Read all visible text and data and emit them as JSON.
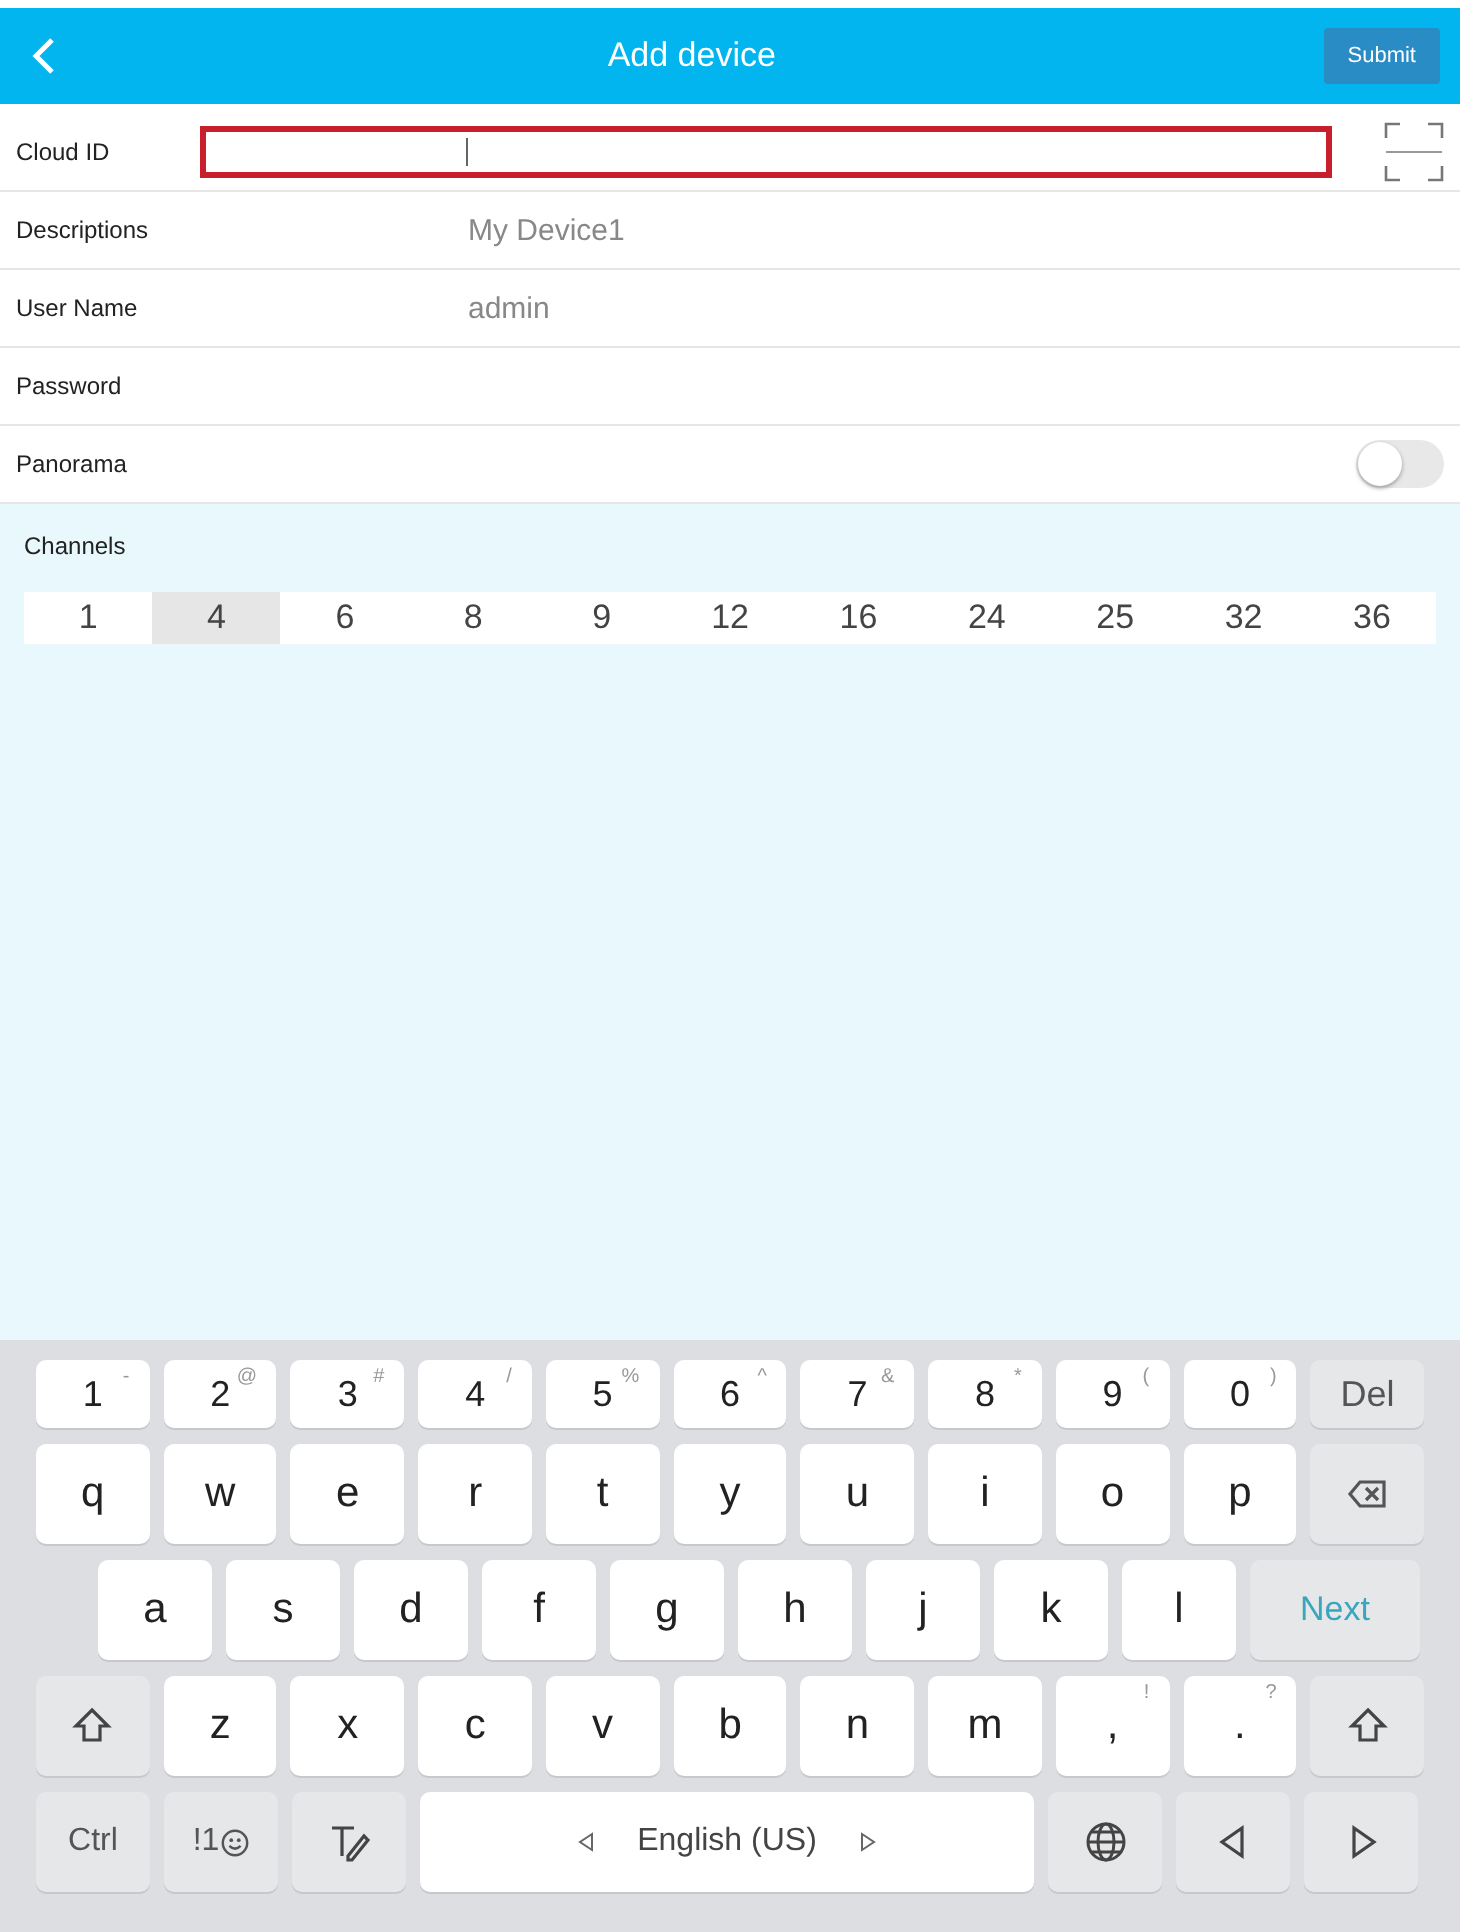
{
  "header": {
    "title": "Add device",
    "submit": "Submit"
  },
  "fields": [
    {
      "label": "Cloud ID",
      "kind": "input",
      "focused": true
    },
    {
      "label": "Descriptions",
      "kind": "input",
      "value": "My Device1"
    },
    {
      "label": "User Name",
      "kind": "input",
      "value": "admin"
    },
    {
      "label": "Password",
      "kind": "input"
    },
    {
      "label": "Panorama",
      "kind": "toggle",
      "on": false
    }
  ],
  "channels": {
    "label": "Channels",
    "options": [
      {
        "label": "1",
        "selected": false
      },
      {
        "label": "4",
        "selected": true
      },
      {
        "label": "6",
        "selected": false
      },
      {
        "label": "8",
        "selected": false
      },
      {
        "label": "9",
        "selected": false
      },
      {
        "label": "12",
        "selected": false
      },
      {
        "label": "16",
        "selected": false
      },
      {
        "label": "24",
        "selected": false
      },
      {
        "label": "25",
        "selected": false
      },
      {
        "label": "32",
        "selected": false
      },
      {
        "label": "36",
        "selected": false
      }
    ]
  },
  "keyboard": {
    "rows": [
      {
        "keys": [
          {
            "kind": "char",
            "label": "1",
            "alt": "-"
          },
          {
            "kind": "char",
            "label": "2",
            "alt": "@"
          },
          {
            "kind": "char",
            "label": "3",
            "alt": "#"
          },
          {
            "kind": "char",
            "label": "4",
            "alt": "/"
          },
          {
            "kind": "char",
            "label": "5",
            "alt": "%"
          },
          {
            "kind": "char",
            "label": "6",
            "alt": "^"
          },
          {
            "kind": "char",
            "label": "7",
            "alt": "&"
          },
          {
            "kind": "char",
            "label": "8",
            "alt": "*"
          },
          {
            "kind": "char",
            "label": "9",
            "alt": "("
          },
          {
            "kind": "char",
            "label": "0",
            "alt": ")"
          },
          {
            "kind": "word",
            "label": "Del"
          }
        ]
      },
      {
        "keys": [
          {
            "kind": "char",
            "label": "q"
          },
          {
            "kind": "char",
            "label": "w"
          },
          {
            "kind": "char",
            "label": "e"
          },
          {
            "kind": "char",
            "label": "r"
          },
          {
            "kind": "char",
            "label": "t"
          },
          {
            "kind": "char",
            "label": "y"
          },
          {
            "kind": "char",
            "label": "u"
          },
          {
            "kind": "char",
            "label": "i"
          },
          {
            "kind": "char",
            "label": "o"
          },
          {
            "kind": "char",
            "label": "p"
          },
          {
            "kind": "backspace"
          }
        ]
      },
      {
        "keys": [
          {
            "kind": "char",
            "label": "a"
          },
          {
            "kind": "char",
            "label": "s"
          },
          {
            "kind": "char",
            "label": "d"
          },
          {
            "kind": "char",
            "label": "f"
          },
          {
            "kind": "char",
            "label": "g"
          },
          {
            "kind": "char",
            "label": "h"
          },
          {
            "kind": "char",
            "label": "j"
          },
          {
            "kind": "char",
            "label": "k"
          },
          {
            "kind": "char",
            "label": "l"
          },
          {
            "kind": "action",
            "label": "Next"
          }
        ]
      },
      {
        "keys": [
          {
            "kind": "shift"
          },
          {
            "kind": "char",
            "label": "z"
          },
          {
            "kind": "char",
            "label": "x"
          },
          {
            "kind": "char",
            "label": "c"
          },
          {
            "kind": "char",
            "label": "v"
          },
          {
            "kind": "char",
            "label": "b"
          },
          {
            "kind": "char",
            "label": "n"
          },
          {
            "kind": "char",
            "label": "m"
          },
          {
            "kind": "char",
            "label": ",",
            "alt": "!"
          },
          {
            "kind": "char",
            "label": ".",
            "alt": "?"
          },
          {
            "kind": "shift"
          }
        ]
      },
      {
        "keys": [
          {
            "kind": "word",
            "label": "Ctrl"
          },
          {
            "kind": "symbols",
            "label": "!1"
          },
          {
            "kind": "handwriting"
          },
          {
            "kind": "space",
            "label": "English (US)"
          },
          {
            "kind": "globe"
          },
          {
            "kind": "left"
          },
          {
            "kind": "right"
          }
        ]
      }
    ]
  }
}
